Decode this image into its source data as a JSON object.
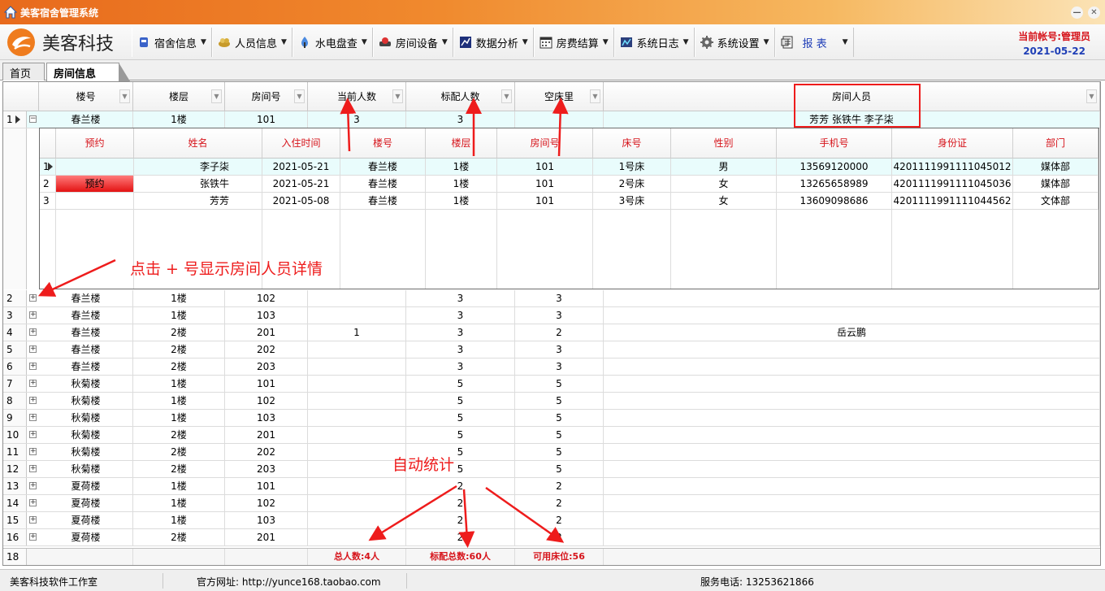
{
  "window": {
    "title": "美客宿舍管理系统",
    "minimize_icon": "minimize-icon",
    "close_icon": "close-icon"
  },
  "toolbar": {
    "brand": "美客科技",
    "menus": [
      {
        "label": "宿舍信息",
        "icon": "dorm-icon"
      },
      {
        "label": "人员信息",
        "icon": "people-icon"
      },
      {
        "label": "水电盘查",
        "icon": "utility-icon"
      },
      {
        "label": "房间设备",
        "icon": "device-icon"
      },
      {
        "label": "数据分析",
        "icon": "chart-icon"
      },
      {
        "label": "房费结算",
        "icon": "calendar-icon"
      },
      {
        "label": "系统日志",
        "icon": "log-icon"
      },
      {
        "label": "系统设置",
        "icon": "gear-icon"
      },
      {
        "label": "报 表",
        "icon": "report-icon"
      }
    ],
    "account": "当前帐号:管理员",
    "date": "2021-05-22"
  },
  "tabs": {
    "home": "首页",
    "active": "房间信息"
  },
  "grid": {
    "columns": [
      "楼号",
      "楼层",
      "房间号",
      "当前人数",
      "标配人数",
      "空床里",
      "房间人员"
    ],
    "rows": [
      {
        "n": "1",
        "expanded": true,
        "building": "春兰楼",
        "floor": "1楼",
        "room": "101",
        "current": "3",
        "standard": "3",
        "empty": "",
        "members": "芳芳  张铁牛  李子柒"
      },
      {
        "n": "2",
        "building": "春兰楼",
        "floor": "1楼",
        "room": "102",
        "current": "",
        "standard": "3",
        "empty": "3",
        "members": ""
      },
      {
        "n": "3",
        "building": "春兰楼",
        "floor": "1楼",
        "room": "103",
        "current": "",
        "standard": "3",
        "empty": "3",
        "members": ""
      },
      {
        "n": "4",
        "building": "春兰楼",
        "floor": "2楼",
        "room": "201",
        "current": "1",
        "standard": "3",
        "empty": "2",
        "members": "岳云鹏"
      },
      {
        "n": "5",
        "building": "春兰楼",
        "floor": "2楼",
        "room": "202",
        "current": "",
        "standard": "3",
        "empty": "3",
        "members": ""
      },
      {
        "n": "6",
        "building": "春兰楼",
        "floor": "2楼",
        "room": "203",
        "current": "",
        "standard": "3",
        "empty": "3",
        "members": ""
      },
      {
        "n": "7",
        "building": "秋菊楼",
        "floor": "1楼",
        "room": "101",
        "current": "",
        "standard": "5",
        "empty": "5",
        "members": ""
      },
      {
        "n": "8",
        "building": "秋菊楼",
        "floor": "1楼",
        "room": "102",
        "current": "",
        "standard": "5",
        "empty": "5",
        "members": ""
      },
      {
        "n": "9",
        "building": "秋菊楼",
        "floor": "1楼",
        "room": "103",
        "current": "",
        "standard": "5",
        "empty": "5",
        "members": ""
      },
      {
        "n": "10",
        "building": "秋菊楼",
        "floor": "2楼",
        "room": "201",
        "current": "",
        "standard": "5",
        "empty": "5",
        "members": ""
      },
      {
        "n": "11",
        "building": "秋菊楼",
        "floor": "2楼",
        "room": "202",
        "current": "",
        "standard": "5",
        "empty": "5",
        "members": ""
      },
      {
        "n": "12",
        "building": "秋菊楼",
        "floor": "2楼",
        "room": "203",
        "current": "",
        "standard": "5",
        "empty": "5",
        "members": ""
      },
      {
        "n": "13",
        "building": "夏荷楼",
        "floor": "1楼",
        "room": "101",
        "current": "",
        "standard": "2",
        "empty": "2",
        "members": ""
      },
      {
        "n": "14",
        "building": "夏荷楼",
        "floor": "1楼",
        "room": "102",
        "current": "",
        "standard": "2",
        "empty": "2",
        "members": ""
      },
      {
        "n": "15",
        "building": "夏荷楼",
        "floor": "1楼",
        "room": "103",
        "current": "",
        "standard": "2",
        "empty": "2",
        "members": ""
      },
      {
        "n": "16",
        "building": "夏荷楼",
        "floor": "2楼",
        "room": "201",
        "current": "",
        "standard": "2",
        "empty": "2",
        "members": ""
      }
    ],
    "footer": {
      "n": "18",
      "total_people": "总人数:4人",
      "total_standard": "标配总数:60人",
      "available_beds": "可用床位:56"
    }
  },
  "detail": {
    "columns": [
      "预约",
      "姓名",
      "入住时间",
      "楼号",
      "楼层",
      "房间号",
      "床号",
      "性别",
      "手机号",
      "身份证",
      "部门"
    ],
    "rows": [
      {
        "n": "1",
        "reserve": "",
        "name": "李子柒",
        "date": "2021-05-21",
        "building": "春兰楼",
        "floor": "1楼",
        "room": "101",
        "bed": "1号床",
        "gender": "男",
        "phone": "13569120000",
        "id": "4201111991111045012",
        "dept": "媒体部"
      },
      {
        "n": "2",
        "reserve": "预约",
        "name": "张铁牛",
        "date": "2021-05-21",
        "building": "春兰楼",
        "floor": "1楼",
        "room": "101",
        "bed": "2号床",
        "gender": "女",
        "phone": "13265658989",
        "id": "4201111991111045036",
        "dept": "媒体部"
      },
      {
        "n": "3",
        "reserve": "",
        "name": "芳芳",
        "date": "2021-05-08",
        "building": "春兰楼",
        "floor": "1楼",
        "room": "101",
        "bed": "3号床",
        "gender": "女",
        "phone": "13609098686",
        "id": "4201111991111044562",
        "dept": "文体部"
      }
    ]
  },
  "annotations": {
    "expand_hint": "点击 + 号显示房间人员详情",
    "auto_stat": "自动统计",
    "color": "#ee1c1c"
  },
  "status": {
    "studio": "美客科技软件工作室",
    "website": "官方网址:  http://yunce168.taobao.com",
    "phone": "服务电话:  13253621866"
  }
}
